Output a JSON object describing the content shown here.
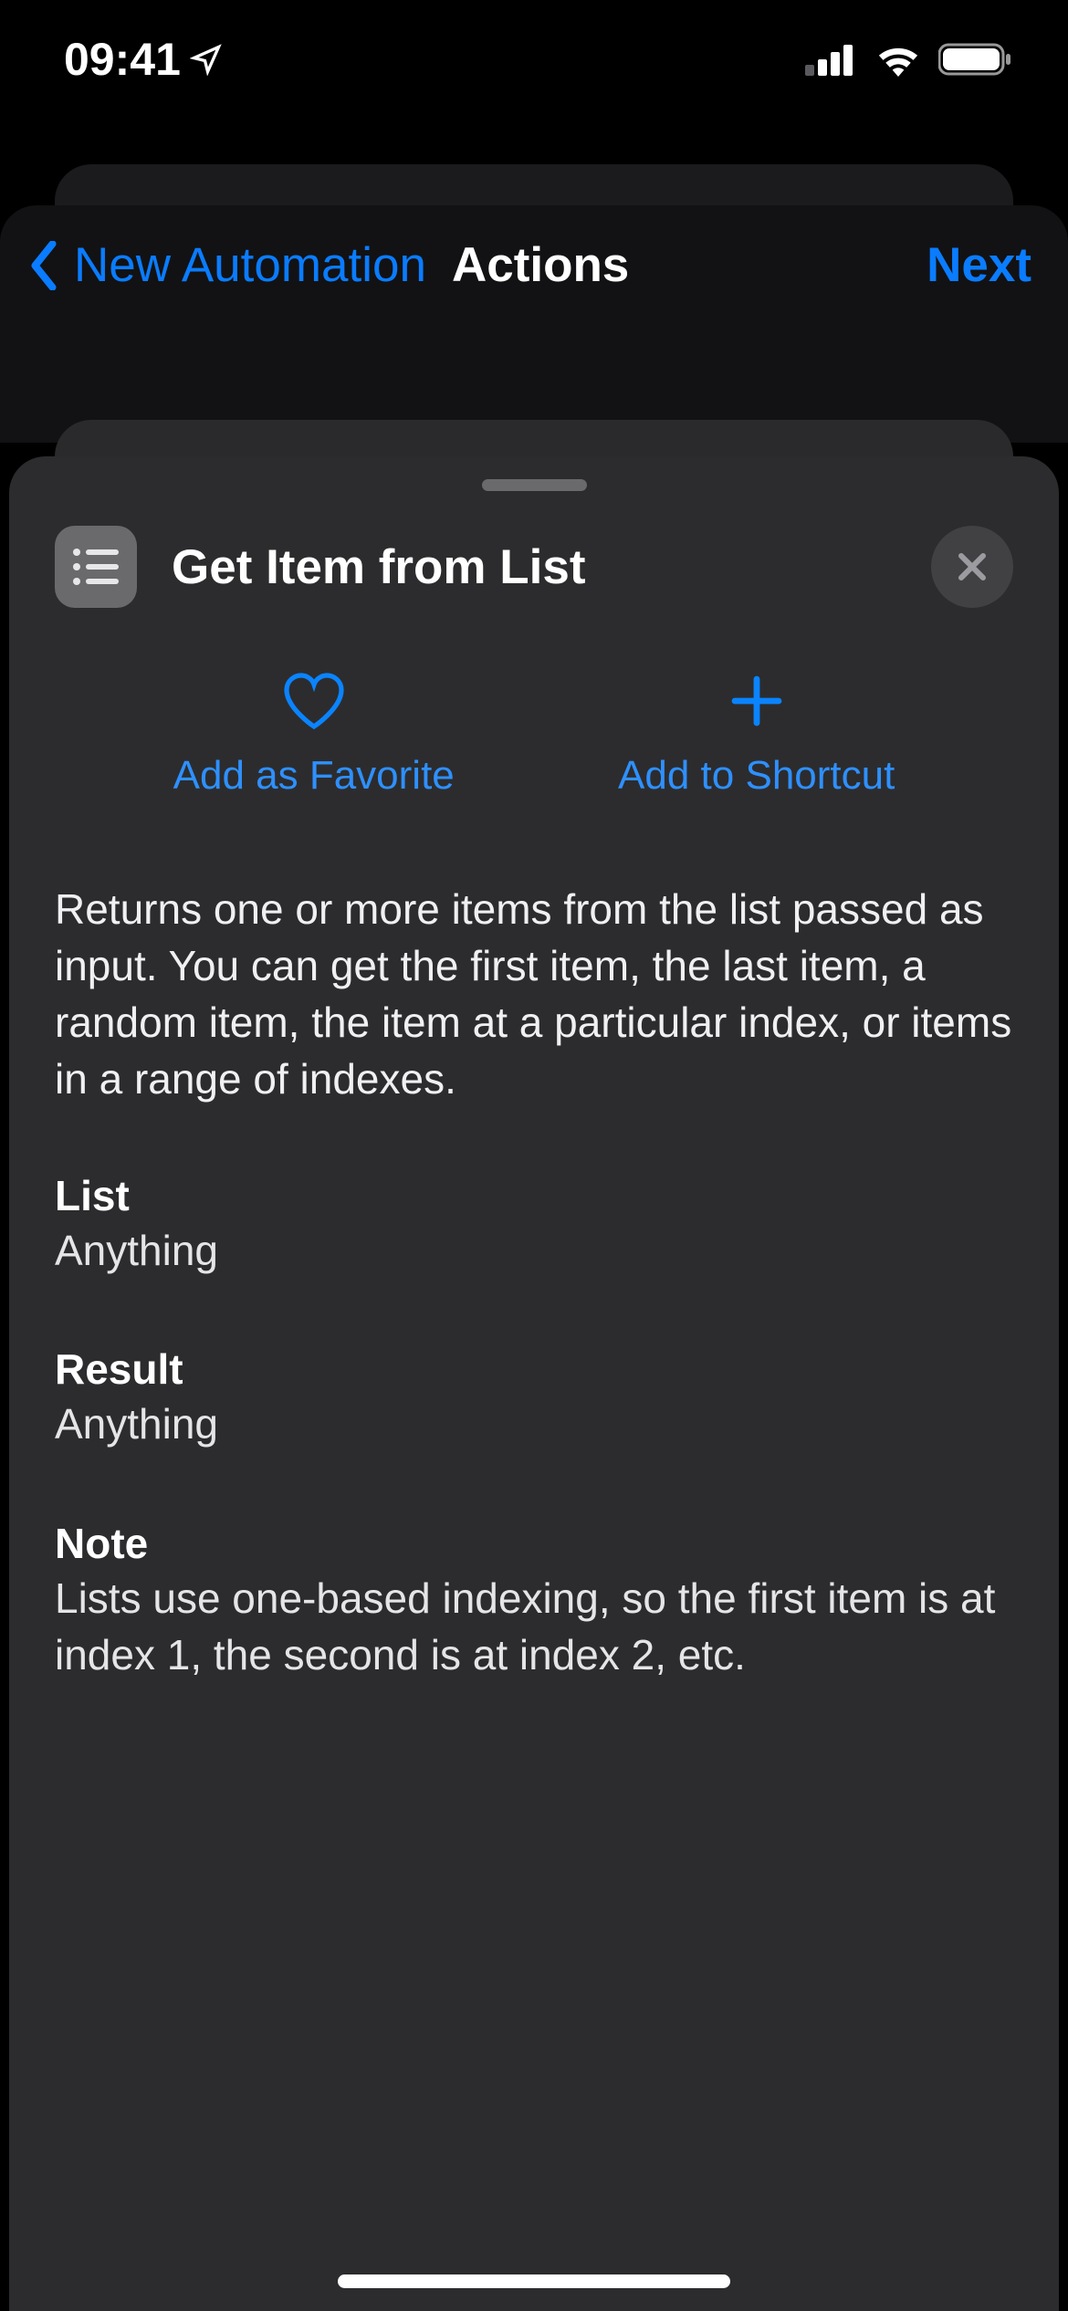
{
  "status": {
    "time": "09:41"
  },
  "nav": {
    "back_label": "New Automation",
    "title": "Actions",
    "next_label": "Next"
  },
  "sheet": {
    "title": "Get Item from List",
    "favorite_label": "Add as Favorite",
    "shortcut_label": "Add to Shortcut",
    "description": "Returns one or more items from the list passed as input. You can get the first item, the last item, a random item, the item at a particular index, or items in a range of indexes.",
    "sections": {
      "list": {
        "heading": "List",
        "value": "Anything"
      },
      "result": {
        "heading": "Result",
        "value": "Anything"
      },
      "note": {
        "heading": "Note",
        "value": "Lists use one-based indexing, so the first item is at index 1, the second is at index 2, etc."
      }
    }
  }
}
